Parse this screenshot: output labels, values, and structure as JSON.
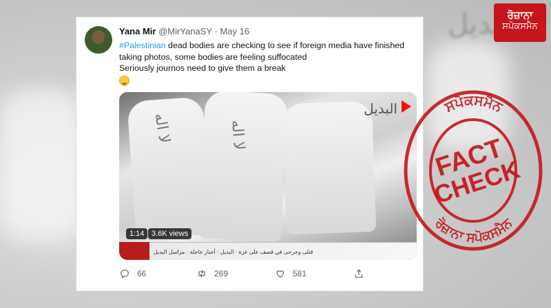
{
  "tweet": {
    "display_name": "Yana Mir",
    "handle": "@MirYanaSY",
    "separator": "·",
    "date": "May 16",
    "hashtag": "#Palestinian",
    "line1_rest": " dead bodies are checking to see if foreign media have finished",
    "line2": "taking photos, some bodies are feeling suffocated",
    "line3": "Seriously journos need to give them a break",
    "emoji_icon": "grinning-sweat-emoji"
  },
  "video": {
    "duration": "1:14",
    "views": "3.6K views",
    "channel_logo": "البديل",
    "ticker_text": "قتلى وجرحى في قصف على غزة · البديل · أخبار عاجلة · مراسل البديل"
  },
  "actions": {
    "replies": "66",
    "retweets": "269",
    "likes": "581"
  },
  "branding": {
    "logo_line1": "ਰੋਜ਼ਾਨਾ",
    "logo_line2": "ਸਪੋਕਸਮੈਨ",
    "stamp_main_line1": "FACT",
    "stamp_main_line2": "CHECK",
    "stamp_ring_top": "ਸਪੋਕਸਮੈਨ",
    "stamp_ring_bottom": "ਰੋਜ਼ਾਨਾ ਸਪੋਕਸਮੈਨ",
    "stamp_color": "#c4161c"
  },
  "colors": {
    "link": "#1d9bf0",
    "muted": "#536471",
    "text": "#0f1419"
  }
}
